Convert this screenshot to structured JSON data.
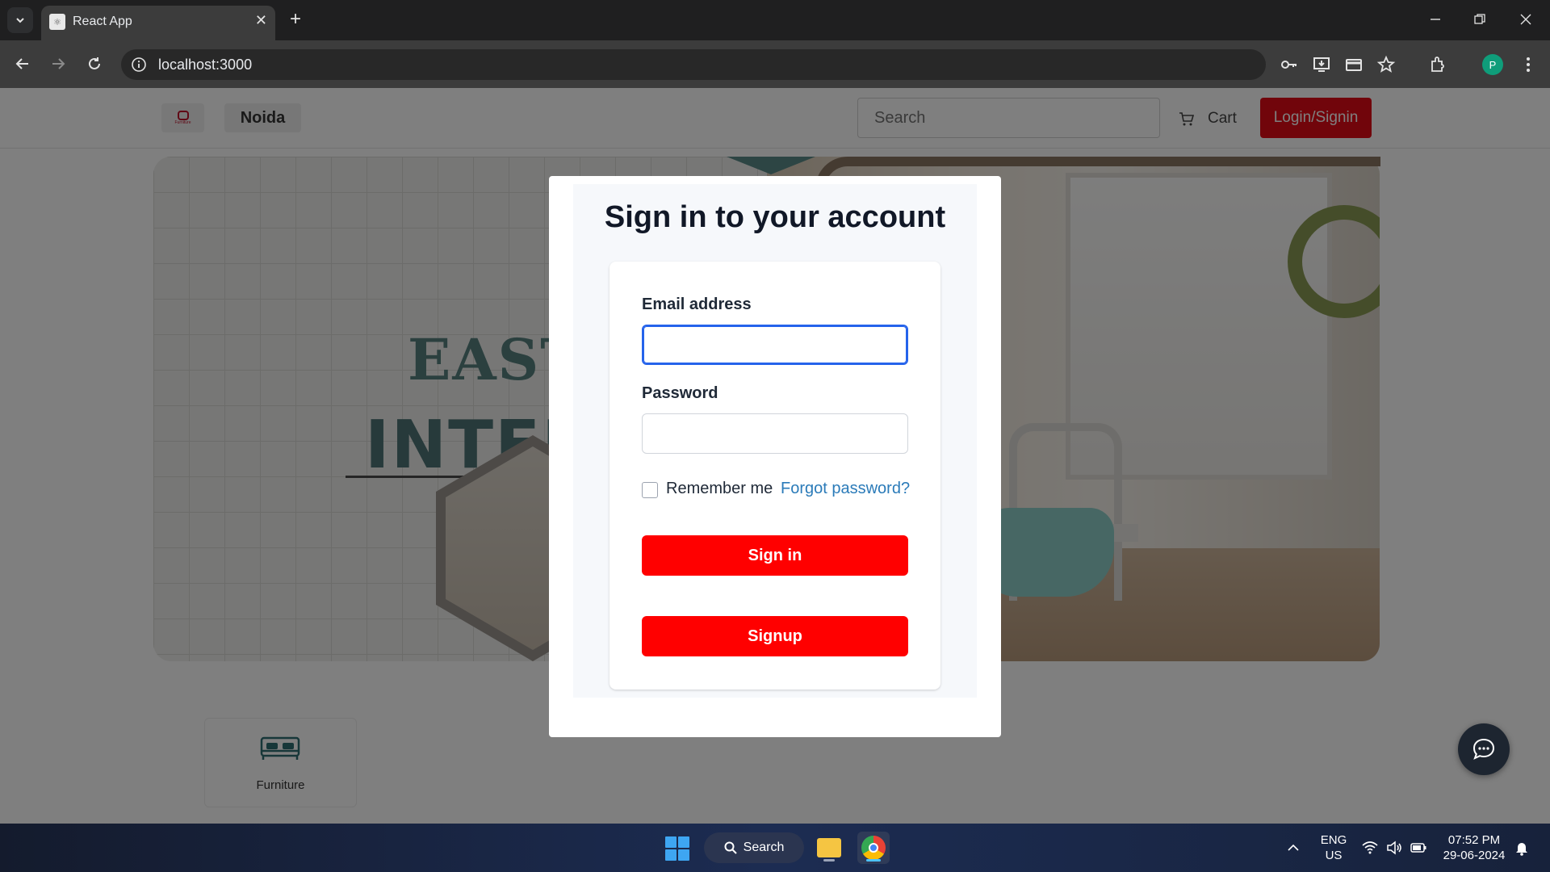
{
  "browser": {
    "tab_title": "React App",
    "url": "localhost:3000",
    "profile_initial": "P"
  },
  "site": {
    "logo_text": "Furniture",
    "city": "Noida",
    "search_placeholder": "Search",
    "cart_label": "Cart",
    "login_label": "Login/Signin",
    "banner_line1": "EASTER",
    "banner_line2": "INTERIOR",
    "category_label": "Furniture"
  },
  "modal": {
    "heading": "Sign in to your account",
    "email_label": "Email address",
    "email_value": "",
    "password_label": "Password",
    "password_value": "",
    "remember_label": "Remember me",
    "forgot_label": "Forgot password?",
    "signin_label": "Sign in",
    "signup_label": "Signup"
  },
  "taskbar": {
    "search_label": "Search",
    "lang_1": "ENG",
    "lang_2": "US",
    "time": "07:52 PM",
    "date": "29-06-2024"
  },
  "colors": {
    "brand_red": "#e30b17",
    "button_red": "#ff0000",
    "focus_blue": "#2563eb",
    "link_blue": "#2b7bb9"
  }
}
